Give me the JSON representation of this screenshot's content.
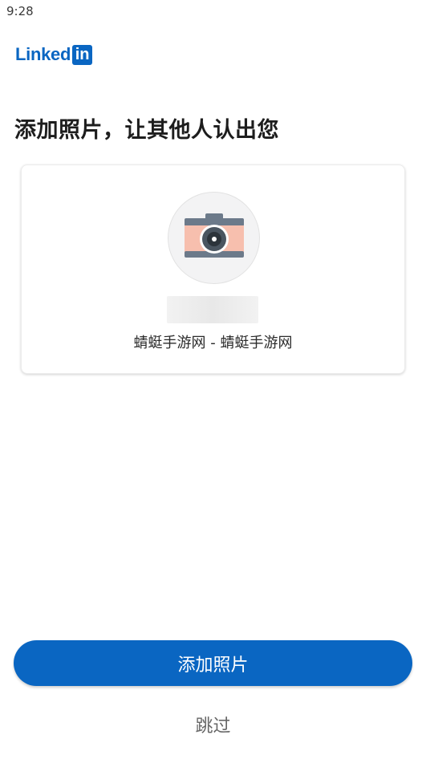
{
  "status_bar": {
    "time": "9:28"
  },
  "logo": {
    "text": "Linked",
    "box_text": "in"
  },
  "page_title": "添加照片，让其他人认出您",
  "card": {
    "avatar_icon": "camera-icon",
    "subtitle": "蜻蜓手游网 - 蜻蜓手游网"
  },
  "actions": {
    "add_photo_label": "添加照片",
    "skip_label": "跳过"
  },
  "colors": {
    "brand_blue": "#0a66c2",
    "camera_pink": "#f7bfae",
    "camera_gray": "#6c7a8a"
  }
}
